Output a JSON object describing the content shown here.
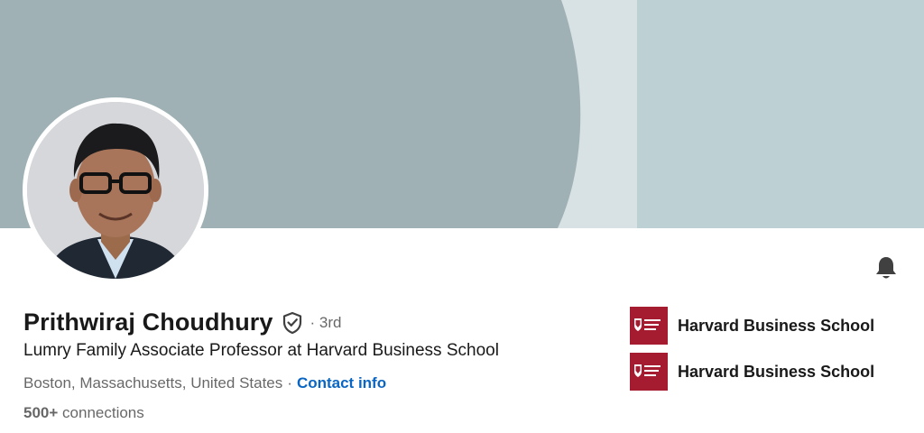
{
  "profile": {
    "name": "Prithwiraj Choudhury",
    "degree": "· 3rd",
    "headline": "Lumry Family Associate Professor at Harvard Business School",
    "location": "Boston, Massachusetts, United States",
    "separator": "·",
    "contact_label": "Contact info",
    "connections_count": "500+",
    "connections_label": "connections"
  },
  "organizations": [
    {
      "name": "Harvard Business School",
      "logo": "harvard-business-school-logo"
    },
    {
      "name": "Harvard Business School",
      "logo": "harvard-business-school-logo"
    }
  ],
  "icons": {
    "verified": "shield-check-icon",
    "notifications": "bell-icon"
  },
  "colors": {
    "banner_main": "#9fb1b4",
    "banner_light": "#d8e2e4",
    "banner_right": "#bdd1d5",
    "link": "#0a66c2",
    "org_logo": "#a51c30"
  }
}
